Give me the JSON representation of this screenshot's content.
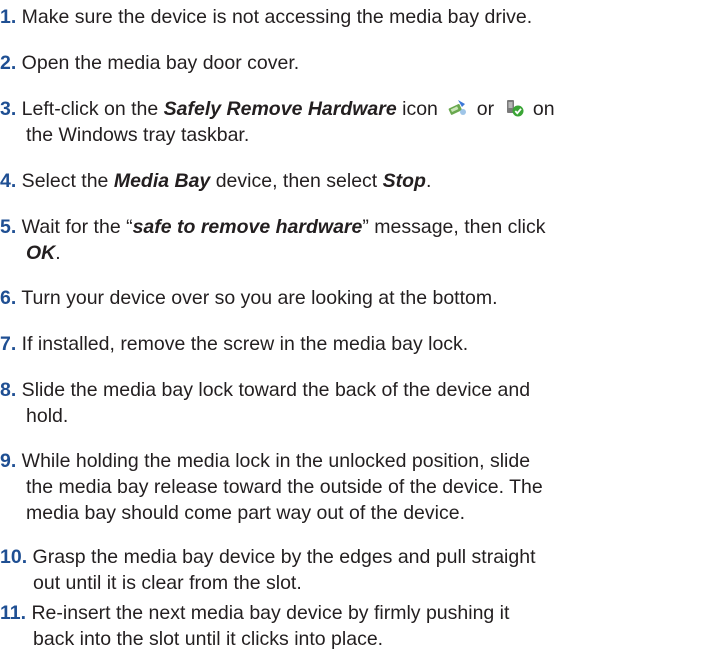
{
  "steps": [
    {
      "number": "1.",
      "text": " Make sure the device is not accessing the media bay drive."
    },
    {
      "number": "2.",
      "text": " Open the media bay door cover."
    },
    {
      "number": "3.",
      "pre": " Left-click on the ",
      "emphasis": "Safely Remove Hardware",
      "mid": " icon ",
      "or": " or ",
      "line2": "the Windows tray taskbar.",
      "post_end": " on",
      "icons": [
        "safely-remove-hardware-icon",
        "safely-remove-hardware-alt-icon"
      ]
    },
    {
      "number": "4.",
      "pre": " Select the ",
      "emphasis1": "Media Bay",
      "mid": " device, then select ",
      "emphasis2": "Stop",
      "end": "."
    },
    {
      "number": "5.",
      "pre": "  Wait for the “",
      "emphasis": "safe to remove hardware",
      "mid": "”  message, then click",
      "emphasis2": "OK",
      "end": "."
    },
    {
      "number": "6.",
      "text": " Turn your device over so you are looking at the bottom."
    },
    {
      "number": "7.",
      "text": " If installed, remove the screw in the media bay lock."
    },
    {
      "number": "8.",
      "line1": " Slide the media bay lock toward the back of the device and",
      "line2": "hold."
    },
    {
      "number": "9.",
      "line1": " While holding the media lock in the unlocked position, slide",
      "line2": "the media bay release toward the outside of the device. The",
      "line3": "media bay should come part way out of the device."
    },
    {
      "number": "10.",
      "line1": " Grasp the media bay device by the edges and pull straight",
      "line2": "out until it is clear from the slot."
    },
    {
      "number": "11.",
      "line1": " Re-insert the next media bay device by firmly pushing it",
      "line2": "back into the slot until it clicks into place."
    }
  ]
}
